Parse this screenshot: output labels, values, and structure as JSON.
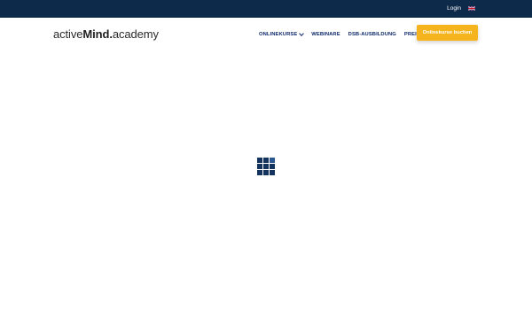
{
  "topbar": {
    "login_label": "Login",
    "language_icon": "uk-flag-icon"
  },
  "header": {
    "logo": {
      "part1": "active",
      "part2": "Mind",
      "part3": ".",
      "part4": "academy"
    },
    "nav": [
      {
        "label": "ONLINEKURSE",
        "has_dropdown": true
      },
      {
        "label": "WEBINARE"
      },
      {
        "label": "DSB-AUSBILDUNG"
      },
      {
        "label": "PREISE"
      }
    ],
    "cta_label": "Onlinekurse buchen"
  },
  "loader": {
    "icon": "loading-grid-icon"
  },
  "colors": {
    "topbar_bg": "#0e2a4a",
    "nav_text": "#0e2a6b",
    "cta_bg": "#f5b31e",
    "loader": "#14325e"
  }
}
